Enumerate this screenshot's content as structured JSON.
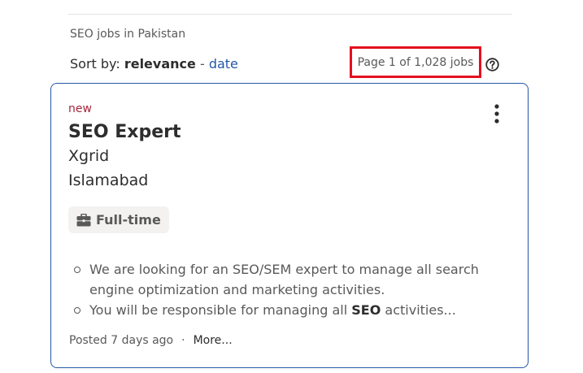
{
  "search": {
    "context": "SEO jobs in Pakistan"
  },
  "sort": {
    "prefix": "Sort by: ",
    "active": "relevance",
    "separator": " - ",
    "alternate": "date"
  },
  "results": {
    "page_count": "Page 1 of 1,028 jobs",
    "highlight_color": "#e4101d"
  },
  "job": {
    "badge": "new",
    "title": "SEO Expert",
    "company": "Xgrid",
    "location": "Islamabad",
    "job_type": "Full-time",
    "snippet": {
      "bullet1_line1": "We are looking for an SEO/SEM expert to manage all search",
      "bullet1_line2": "engine optimization and marketing activities.",
      "bullet2_pre": "You will be responsible for managing all ",
      "bullet2_bold": "SEO",
      "bullet2_post": " activities..."
    },
    "posted": "Posted 7 days ago",
    "separator": "·",
    "more_label": "More..."
  },
  "colors": {
    "card_border": "#2557a7",
    "link": "#2557a7",
    "new_badge": "#a9253c"
  },
  "icons": {
    "help": "question-circle-icon",
    "more_options": "vertical-ellipsis-icon",
    "job_type": "briefcase-icon"
  }
}
